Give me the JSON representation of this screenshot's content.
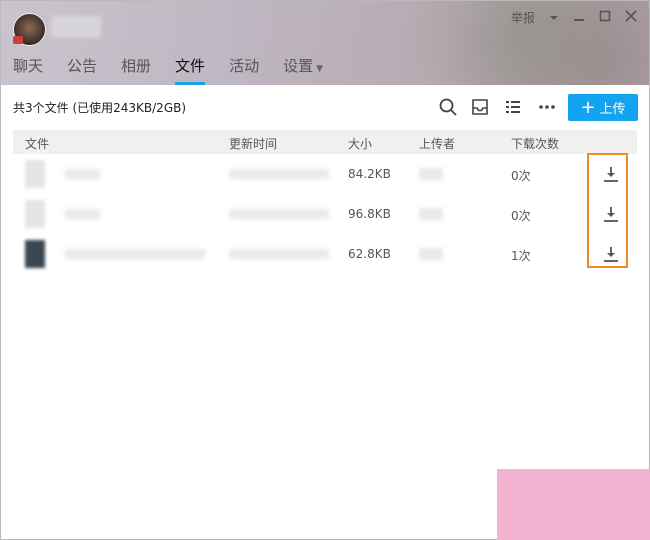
{
  "header": {
    "report_label": "举报",
    "tabs": [
      {
        "label": "聊天"
      },
      {
        "label": "公告"
      },
      {
        "label": "相册"
      },
      {
        "label": "文件"
      },
      {
        "label": "活动"
      },
      {
        "label": "设置"
      }
    ],
    "active_tab": "文件"
  },
  "toolbar": {
    "summary": "共3个文件 (已使用243KB/2GB)",
    "upload_label": "上传",
    "icons": [
      "search-icon",
      "inbox-icon",
      "list-view-icon",
      "more-icon"
    ]
  },
  "table": {
    "columns": [
      "文件",
      "更新时间",
      "大小",
      "上传者",
      "下载次数"
    ],
    "rows": [
      {
        "size": "84.2KB",
        "downloads": "0次"
      },
      {
        "size": "96.8KB",
        "downloads": "0次"
      },
      {
        "size": "62.8KB",
        "downloads": "1次"
      }
    ]
  },
  "colors": {
    "accent": "#12a4f0",
    "highlight": "#ef8a2a"
  }
}
